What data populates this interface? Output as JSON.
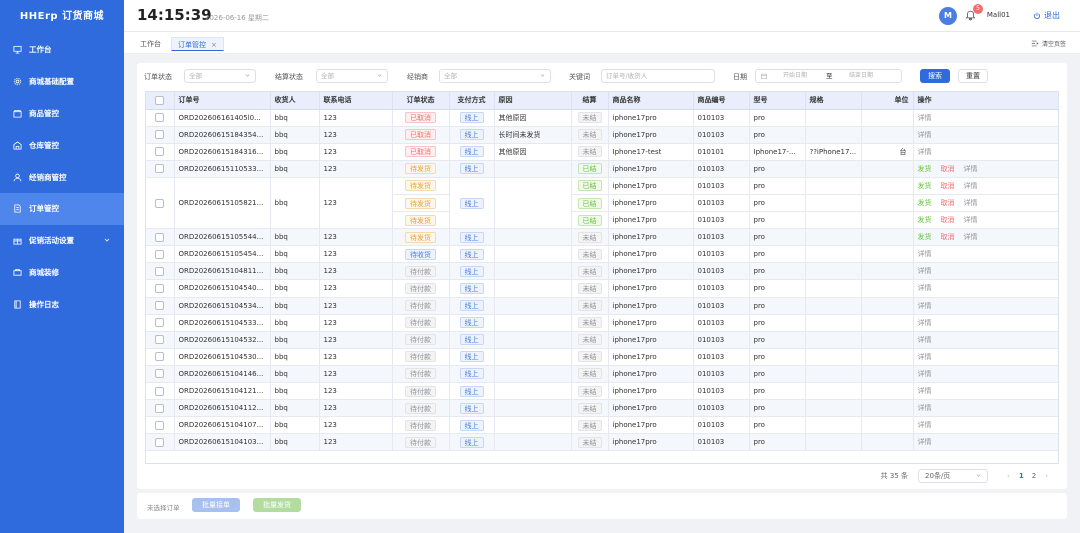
{
  "app": {
    "brand": "HHErp 订货商城"
  },
  "sidebar": {
    "items": [
      {
        "label": "工作台",
        "icon": "monitor-icon"
      },
      {
        "label": "商城基础配置",
        "icon": "settings-icon"
      },
      {
        "label": "商品管控",
        "icon": "store-icon"
      },
      {
        "label": "仓库管控",
        "icon": "warehouse-icon"
      },
      {
        "label": "经销商管控",
        "icon": "user-icon"
      },
      {
        "label": "订单管控",
        "icon": "document-icon"
      },
      {
        "label": "促销活动设置",
        "icon": "gift-icon"
      },
      {
        "label": "商城装修",
        "icon": "palette-icon"
      },
      {
        "label": "操作日志",
        "icon": "book-icon"
      }
    ]
  },
  "header": {
    "time": "14:15:39",
    "date": "2026-06-16 星期二",
    "avatar": "M",
    "notifications": "5",
    "username": "Mall01",
    "logout": "退出"
  },
  "tabs": {
    "home": "工作台",
    "current": "订单管控",
    "close_all": "清空页签"
  },
  "filters": {
    "order_status_label": "订单状态",
    "order_status_value": "全部",
    "settle_status_label": "结算状态",
    "settle_status_value": "全部",
    "dealer_label": "经销商",
    "dealer_value": "全部",
    "keyword_label": "关键词",
    "keyword_placeholder": "订单号/收货人",
    "date_label": "日期",
    "date_start": "开始日期",
    "date_to": "至",
    "date_end": "结束日期",
    "search": "搜索",
    "reset": "重置"
  },
  "table": {
    "headers": [
      "订单号",
      "收货人",
      "联系电话",
      "订单状态",
      "支付方式",
      "原因",
      "结算",
      "商品名称",
      "商品编号",
      "型号",
      "规格",
      "单位",
      "操作"
    ],
    "rows": [
      {
        "order": "ORD202606161405l0...",
        "receiver": "bbq",
        "phone": "123",
        "status": "已取消",
        "pay": "线上",
        "reason": "其他原因",
        "settle": "未结",
        "product": "iphone17pro",
        "code": "010103",
        "model": "pro",
        "spec": "",
        "unit": "",
        "ops": [
          "详情"
        ]
      },
      {
        "order": "ORD20260615184354...",
        "receiver": "bbq",
        "phone": "123",
        "status": "已取消",
        "pay": "线上",
        "reason": "长时间未发货",
        "settle": "未结",
        "product": "iphone17pro",
        "code": "010103",
        "model": "pro",
        "spec": "",
        "unit": "",
        "ops": [
          "详情"
        ]
      },
      {
        "order": "ORD20260615184316...",
        "receiver": "bbq",
        "phone": "123",
        "status": "已取消",
        "pay": "线上",
        "reason": "其他原因",
        "settle": "未结",
        "product": "Iphone17-test",
        "code": "010101",
        "model": "Iphone17-...",
        "spec": "??iPhone17...",
        "unit": "台",
        "ops": [
          "详情"
        ]
      },
      {
        "order": "ORD20260615110533...",
        "receiver": "bbq",
        "phone": "123",
        "status": "待发货",
        "pay": "线上",
        "reason": "",
        "settle": "已结",
        "product": "iphone17pro",
        "code": "010103",
        "model": "pro",
        "spec": "",
        "unit": "",
        "ops": [
          "发货",
          "取消",
          "详情"
        ]
      }
    ],
    "group_row": {
      "order": "ORD20260615105821...",
      "receiver": "bbq",
      "phone": "123",
      "pay": "线上",
      "reason": "",
      "lines": [
        {
          "status": "待发货",
          "settle": "已结",
          "product": "iphone17pro",
          "code": "010103",
          "model": "pro",
          "ops": [
            "发货",
            "取消",
            "详情"
          ]
        },
        {
          "status": "待发货",
          "settle": "已结",
          "product": "iphone17pro",
          "code": "010103",
          "model": "pro",
          "ops": [
            "发货",
            "取消",
            "详情"
          ]
        },
        {
          "status": "待发货",
          "settle": "已结",
          "product": "iphone17pro",
          "code": "010103",
          "model": "pro",
          "ops": [
            "发货",
            "取消",
            "详情"
          ]
        }
      ]
    },
    "rows2": [
      {
        "order": "ORD20260615105544...",
        "receiver": "bbq",
        "phone": "123",
        "status": "待发货",
        "pay": "线上",
        "reason": "",
        "settle": "未结",
        "product": "iphone17pro",
        "code": "010103",
        "model": "pro",
        "spec": "",
        "unit": "",
        "ops": [
          "发货",
          "取消",
          "详情"
        ]
      },
      {
        "order": "ORD20260615105454...",
        "receiver": "bbq",
        "phone": "123",
        "status": "待收货",
        "pay": "线上",
        "reason": "",
        "settle": "未结",
        "product": "iphone17pro",
        "code": "010103",
        "model": "pro",
        "spec": "",
        "unit": "",
        "ops": [
          "详情"
        ]
      },
      {
        "order": "ORD20260615104811...",
        "receiver": "bbq",
        "phone": "123",
        "status": "待付款",
        "pay": "线上",
        "reason": "",
        "settle": "未结",
        "product": "iphone17pro",
        "code": "010103",
        "model": "pro",
        "spec": "",
        "unit": "",
        "ops": [
          "详情"
        ]
      },
      {
        "order": "ORD20260615104540...",
        "receiver": "bbq",
        "phone": "123",
        "status": "待付款",
        "pay": "线上",
        "reason": "",
        "settle": "未结",
        "product": "iphone17pro",
        "code": "010103",
        "model": "pro",
        "spec": "",
        "unit": "",
        "ops": [
          "详情"
        ]
      },
      {
        "order": "ORD20260615104534...",
        "receiver": "bbq",
        "phone": "123",
        "status": "待付款",
        "pay": "线上",
        "reason": "",
        "settle": "未结",
        "product": "iphone17pro",
        "code": "010103",
        "model": "pro",
        "spec": "",
        "unit": "",
        "ops": [
          "详情"
        ]
      },
      {
        "order": "ORD20260615104533...",
        "receiver": "bbq",
        "phone": "123",
        "status": "待付款",
        "pay": "线上",
        "reason": "",
        "settle": "未结",
        "product": "iphone17pro",
        "code": "010103",
        "model": "pro",
        "spec": "",
        "unit": "",
        "ops": [
          "详情"
        ]
      },
      {
        "order": "ORD20260615104532...",
        "receiver": "bbq",
        "phone": "123",
        "status": "待付款",
        "pay": "线上",
        "reason": "",
        "settle": "未结",
        "product": "iphone17pro",
        "code": "010103",
        "model": "pro",
        "spec": "",
        "unit": "",
        "ops": [
          "详情"
        ]
      },
      {
        "order": "ORD20260615104530...",
        "receiver": "bbq",
        "phone": "123",
        "status": "待付款",
        "pay": "线上",
        "reason": "",
        "settle": "未结",
        "product": "iphone17pro",
        "code": "010103",
        "model": "pro",
        "spec": "",
        "unit": "",
        "ops": [
          "详情"
        ]
      },
      {
        "order": "ORD20260615104146...",
        "receiver": "bbq",
        "phone": "123",
        "status": "待付款",
        "pay": "线上",
        "reason": "",
        "settle": "未结",
        "product": "iphone17pro",
        "code": "010103",
        "model": "pro",
        "spec": "",
        "unit": "",
        "ops": [
          "详情"
        ]
      },
      {
        "order": "ORD20260615104121...",
        "receiver": "bbq",
        "phone": "123",
        "status": "待付款",
        "pay": "线上",
        "reason": "",
        "settle": "未结",
        "product": "iphone17pro",
        "code": "010103",
        "model": "pro",
        "spec": "",
        "unit": "",
        "ops": [
          "详情"
        ]
      },
      {
        "order": "ORD20260615104112...",
        "receiver": "bbq",
        "phone": "123",
        "status": "待付款",
        "pay": "线上",
        "reason": "",
        "settle": "未结",
        "product": "iphone17pro",
        "code": "010103",
        "model": "pro",
        "spec": "",
        "unit": "",
        "ops": [
          "详情"
        ]
      },
      {
        "order": "ORD20260615104107...",
        "receiver": "bbq",
        "phone": "123",
        "status": "待付款",
        "pay": "线上",
        "reason": "",
        "settle": "未结",
        "product": "iphone17pro",
        "code": "010103",
        "model": "pro",
        "spec": "",
        "unit": "",
        "ops": [
          "详情"
        ]
      },
      {
        "order": "ORD20260615104103...",
        "receiver": "bbq",
        "phone": "123",
        "status": "待付款",
        "pay": "线上",
        "reason": "",
        "settle": "未结",
        "product": "iphone17pro",
        "code": "010103",
        "model": "pro",
        "spec": "",
        "unit": "",
        "ops": [
          "详情"
        ]
      }
    ]
  },
  "pagination": {
    "total": "共 35 条",
    "page_size": "20条/页",
    "prev": "‹",
    "next": "›",
    "pages": [
      "1",
      "2"
    ],
    "current": "1"
  },
  "bottom": {
    "selected": "未选择订单",
    "batch_accept": "批量接单",
    "batch_ship": "批量发货"
  },
  "colors": {
    "primary": "#2f6bdd",
    "sidebar_active": "#4f86ec",
    "danger": "#f56c6c",
    "warning": "#e6a23c",
    "success": "#67c23a"
  }
}
